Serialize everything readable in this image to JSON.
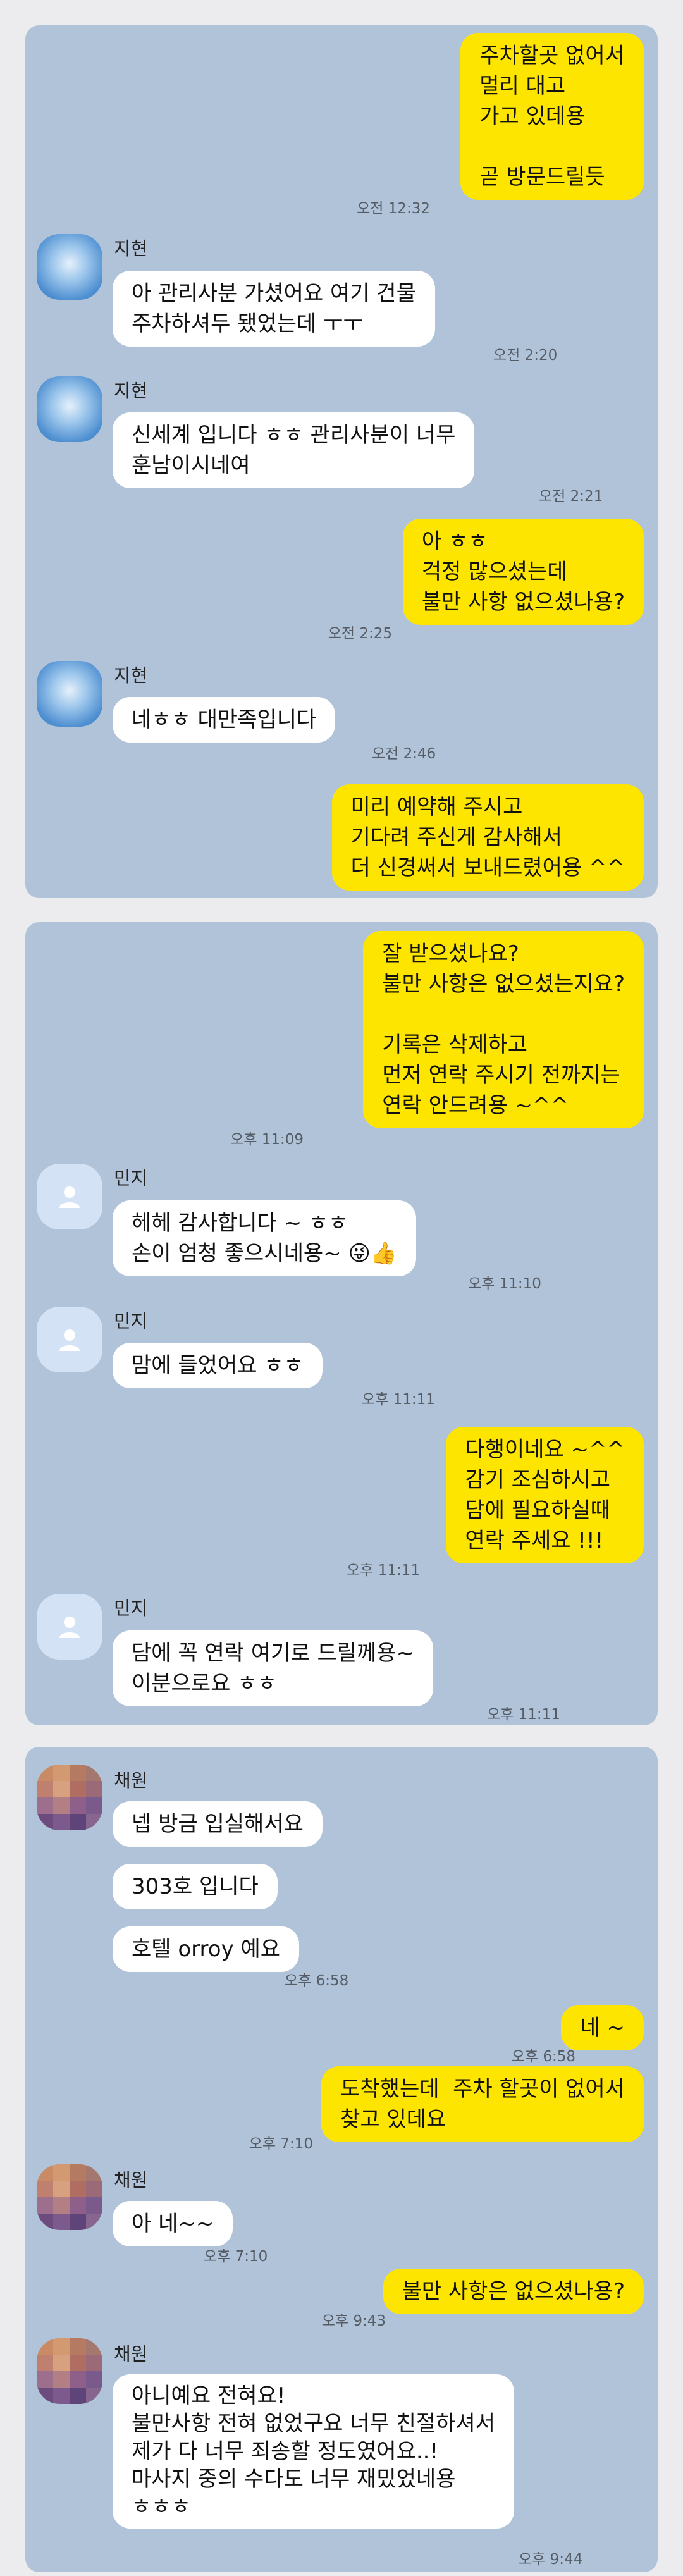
{
  "panel1": {
    "out1": {
      "lines": "주차할곳 없어서\n멀리 대고\n가고 있데용\n\n곧 방문드릴듯",
      "time": "오전 12:32"
    },
    "in1": {
      "name": "지현",
      "text": "아 관리사분 가셨어요 여기 건물\n주차하셔두 됐었는데 ㅜㅜ",
      "time": "오전 2:20"
    },
    "in2": {
      "name": "지현",
      "text": "신세계 입니다 ㅎㅎ 관리사분이 너무\n훈남이시네여",
      "time": "오전 2:21"
    },
    "out2": {
      "lines": "아 ㅎㅎ\n걱정 많으셨는데\n불만 사항 없으셨나용?",
      "time": "오전 2:25"
    },
    "in3": {
      "name": "지현",
      "text": "네ㅎㅎ 대만족입니다",
      "time": "오전 2:46"
    },
    "out3": {
      "lines": "미리 예약해 주시고\n기다려 주신게 감사해서\n더 신경써서 보내드렸어용 ^^"
    }
  },
  "panel2": {
    "out1": {
      "lines": "잘 받으셨나요?\n불만 사항은 없으셨는지요?\n\n기록은 삭제하고\n먼저 연락 주시기 전까지는\n연락 안드려용 ~^^",
      "time": "오후 11:09"
    },
    "in1": {
      "name": "민지",
      "text": "헤헤 감사합니다 ~ ㅎㅎ\n손이 엄청 좋으시네용~ ",
      "emoji": "😜👍",
      "time": "오후 11:10"
    },
    "in2": {
      "name": "민지",
      "text": "맘에 들었어요 ㅎㅎ",
      "time": "오후 11:11"
    },
    "out2": {
      "lines": "다행이네요 ~^^\n감기 조심하시고\n담에 필요하실때\n연락 주세요 !!!",
      "time": "오후 11:11"
    },
    "in3": {
      "name": "민지",
      "text": "담에 꼭 연락 여기로 드릴께용~\n이분으로요 ㅎㅎ",
      "time": "오후 11:11"
    }
  },
  "panel3": {
    "in1": {
      "name": "채원",
      "text": "넵 방금 입실해서요"
    },
    "in2": {
      "text": "303호 입니다"
    },
    "in3": {
      "text": "호텔 orroy 예요",
      "time": "오후 6:58"
    },
    "out1": {
      "lines": "네 ~",
      "time": "오후 6:58"
    },
    "out2": {
      "lines": "도착했는데  주차 할곳이 없어서\n찾고 있데요",
      "time": "오후 7:10"
    },
    "in4": {
      "name": "채원",
      "text": "아 네~~",
      "time": "오후 7:10"
    },
    "out3": {
      "lines": "불만 사항은 없으셨나용?",
      "time": "오후 9:43"
    },
    "in5": {
      "name": "채원",
      "text": "아니예요 전혀요!\n불만사항 전혀 없었구요 너무 친절하셔서\n제가 다 너무 죄송할 정도였어요..!\n마사지 중의 수다도 너무 재밌었네용\nㅎㅎㅎ",
      "time": "오후 9:44"
    }
  },
  "colors": {
    "panel": "#b0c3d9",
    "outgoing": "#fee500",
    "incoming": "#ffffff",
    "background": "#ececee"
  }
}
